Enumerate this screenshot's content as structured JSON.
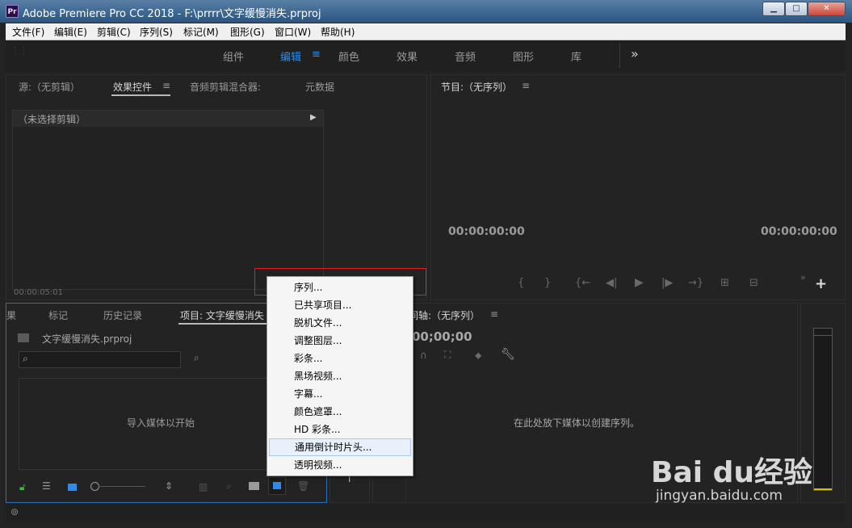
{
  "window": {
    "icon_text": "Pr",
    "title": "Adobe Premiere Pro CC 2018 - F:\\prrrr\\文字缓慢消失.prproj",
    "min": "▁",
    "max": "□",
    "close": "✕"
  },
  "menubar": [
    "文件(F)",
    "编辑(E)",
    "剪辑(C)",
    "序列(S)",
    "标记(M)",
    "图形(G)",
    "窗口(W)",
    "帮助(H)"
  ],
  "workspaces": {
    "items": [
      "组件",
      "编辑",
      "颜色",
      "效果",
      "音频",
      "图形",
      "库"
    ],
    "active": "编辑",
    "more": "»",
    "menu_glyph": "≡"
  },
  "source_panel": {
    "tabs": [
      "源:（无剪辑）",
      "效果控件",
      "音频剪辑混合器:",
      "元数据"
    ],
    "tab_menu": "≡",
    "no_clip": "（未选择剪辑）",
    "timecode": "00:00:05:01"
  },
  "program_panel": {
    "title": "节目:（无序列）",
    "tab_menu": "≡",
    "timecode_left": "00:00:00:00",
    "timecode_right": "00:00:00:00"
  },
  "project_panel": {
    "tabs": [
      "果",
      "标记",
      "历史记录",
      "项目: 文字缓慢消失"
    ],
    "project_file": "文字缓慢消失.prproj",
    "search_placeholder": "",
    "empty_text": "导入媒体以开始"
  },
  "timeline_panel": {
    "title": "时间轴:（无序列）",
    "tab_menu": "≡",
    "timecode": "00;00;00",
    "empty_text": "在此处放下媒体以创建序列。"
  },
  "context_menu": {
    "items": [
      "序列...",
      "已共享项目...",
      "脱机文件...",
      "调整图层...",
      "彩条...",
      "黑场视频...",
      "字幕...",
      "颜色遮罩...",
      "HD 彩条...",
      "通用倒计时片头...",
      "透明视频..."
    ],
    "hovered": "通用倒计时片头..."
  },
  "watermark": {
    "logo": "Bai du经验",
    "url": "jingyan.baidu.com"
  },
  "colors": {
    "accent": "#2d8ceb",
    "highlight_box": "#e02020",
    "panel_bg": "#232323"
  }
}
